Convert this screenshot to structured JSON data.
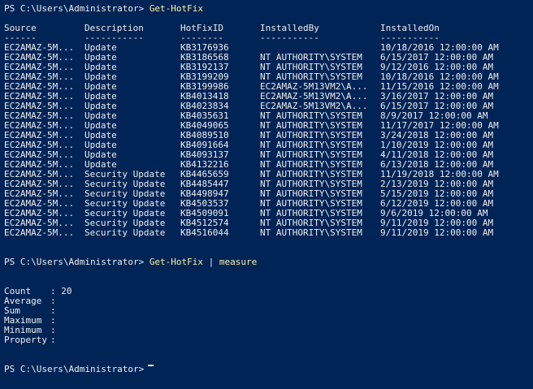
{
  "prompt": "PS C:\\Users\\Administrator>",
  "commands": {
    "first": "Get-HotFix",
    "second_cmd": "Get-HotFix",
    "second_pipe": "|",
    "second_target": "measure",
    "third": ""
  },
  "table": {
    "headers": [
      "Source",
      "Description",
      "HotFixID",
      "InstalledBy",
      "InstalledOn"
    ],
    "underlines": [
      "------",
      "-----------",
      "--------",
      "-----------",
      "-----------"
    ],
    "rows": [
      [
        "EC2AMAZ-5M...",
        "Update",
        "KB3176936",
        "",
        "10/18/2016 12:00:00 AM"
      ],
      [
        "EC2AMAZ-5M...",
        "Update",
        "KB3186568",
        "NT AUTHORITY\\SYSTEM",
        "6/15/2017 12:00:00 AM"
      ],
      [
        "EC2AMAZ-5M...",
        "Update",
        "KB3192137",
        "NT AUTHORITY\\SYSTEM",
        "9/12/2016 12:00:00 AM"
      ],
      [
        "EC2AMAZ-5M...",
        "Update",
        "KB3199209",
        "NT AUTHORITY\\SYSTEM",
        "10/18/2016 12:00:00 AM"
      ],
      [
        "EC2AMAZ-5M...",
        "Update",
        "KB3199986",
        "EC2AMAZ-5M13VM2\\A...",
        "11/15/2016 12:00:00 AM"
      ],
      [
        "EC2AMAZ-5M...",
        "Update",
        "KB4013418",
        "EC2AMAZ-5M13VM2\\A...",
        "3/16/2017 12:00:00 AM"
      ],
      [
        "EC2AMAZ-5M...",
        "Update",
        "KB4023834",
        "EC2AMAZ-5M13VM2\\A...",
        "6/15/2017 12:00:00 AM"
      ],
      [
        "EC2AMAZ-5M...",
        "Update",
        "KB4035631",
        "NT AUTHORITY\\SYSTEM",
        "8/9/2017 12:00:00 AM"
      ],
      [
        "EC2AMAZ-5M...",
        "Update",
        "KB4049065",
        "NT AUTHORITY\\SYSTEM",
        "11/17/2017 12:00:00 AM"
      ],
      [
        "EC2AMAZ-5M...",
        "Update",
        "KB4089510",
        "NT AUTHORITY\\SYSTEM",
        "3/24/2018 12:00:00 AM"
      ],
      [
        "EC2AMAZ-5M...",
        "Update",
        "KB4091664",
        "NT AUTHORITY\\SYSTEM",
        "1/10/2019 12:00:00 AM"
      ],
      [
        "EC2AMAZ-5M...",
        "Update",
        "KB4093137",
        "NT AUTHORITY\\SYSTEM",
        "4/11/2018 12:00:00 AM"
      ],
      [
        "EC2AMAZ-5M...",
        "Update",
        "KB4132216",
        "NT AUTHORITY\\SYSTEM",
        "6/13/2018 12:00:00 AM"
      ],
      [
        "EC2AMAZ-5M...",
        "Security Update",
        "KB4465659",
        "NT AUTHORITY\\SYSTEM",
        "11/19/2018 12:00:00 AM"
      ],
      [
        "EC2AMAZ-5M...",
        "Security Update",
        "KB4485447",
        "NT AUTHORITY\\SYSTEM",
        "2/13/2019 12:00:00 AM"
      ],
      [
        "EC2AMAZ-5M...",
        "Security Update",
        "KB4498947",
        "NT AUTHORITY\\SYSTEM",
        "5/15/2019 12:00:00 AM"
      ],
      [
        "EC2AMAZ-5M...",
        "Security Update",
        "KB4503537",
        "NT AUTHORITY\\SYSTEM",
        "6/12/2019 12:00:00 AM"
      ],
      [
        "EC2AMAZ-5M...",
        "Security Update",
        "KB4509091",
        "NT AUTHORITY\\SYSTEM",
        "9/6/2019 12:00:00 AM"
      ],
      [
        "EC2AMAZ-5M...",
        "Security Update",
        "KB4512574",
        "NT AUTHORITY\\SYSTEM",
        "9/11/2019 12:00:00 AM"
      ],
      [
        "EC2AMAZ-5M...",
        "Security Update",
        "KB4516044",
        "NT AUTHORITY\\SYSTEM",
        "9/11/2019 12:00:00 AM"
      ]
    ]
  },
  "measure": {
    "fields": [
      {
        "label": "Count",
        "value": "20"
      },
      {
        "label": "Average",
        "value": ""
      },
      {
        "label": "Sum",
        "value": ""
      },
      {
        "label": "Maximum",
        "value": ""
      },
      {
        "label": "Minimum",
        "value": ""
      },
      {
        "label": "Property",
        "value": ""
      }
    ],
    "separator": ":"
  },
  "colors": {
    "background": "#012456",
    "text": "#eeedf0",
    "command": "#f9f1a5"
  }
}
